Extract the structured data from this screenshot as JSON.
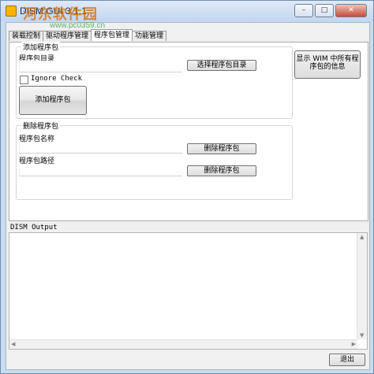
{
  "window": {
    "title": "DISM GUI 3.1.1",
    "watermark": "河东软件园",
    "watermark_url": "www.pc0359.cn",
    "controls": [
      "–",
      "□",
      "✕"
    ]
  },
  "tabs": [
    {
      "label": "装载控制",
      "active": false
    },
    {
      "label": "驱动程序管理",
      "active": false
    },
    {
      "label": "程序包管理",
      "active": true
    },
    {
      "label": "功能管理",
      "active": false
    }
  ],
  "add_package": {
    "group_title": "添加程序包",
    "dir_label": "程序包目录",
    "dir_value": "",
    "browse_button": "选择程序包目录",
    "ignore_check_label": "Ignore Check",
    "ignore_check_checked": false,
    "add_button": "添加程序包"
  },
  "show_info_button": "显示 WIM 中所有程序包的信息",
  "remove_package": {
    "group_title": "删除程序包",
    "name_label": "程序包名称",
    "name_value": "",
    "remove_by_name_button": "删除程序包",
    "path_label": "程序包路径",
    "path_value": "",
    "remove_by_path_button": "删除程序包"
  },
  "output": {
    "label": "DISM Output",
    "content": ""
  },
  "exit_button": "退出"
}
